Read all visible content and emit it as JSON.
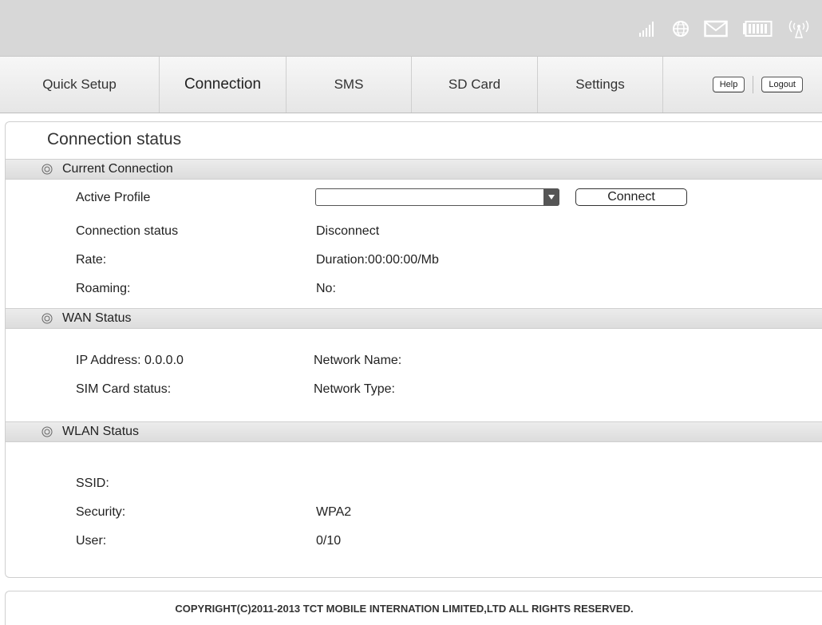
{
  "header": {
    "icons": [
      "signal-icon",
      "internet-globe-icon",
      "sms-envelope-icon",
      "battery-icon",
      "wifi-antenna-icon"
    ]
  },
  "nav": {
    "items": [
      {
        "label": "Quick Setup",
        "active": false
      },
      {
        "label": "Connection",
        "active": true
      },
      {
        "label": "SMS",
        "active": false
      },
      {
        "label": "SD Card",
        "active": false
      },
      {
        "label": "Settings",
        "active": false
      }
    ],
    "help_label": "Help",
    "logout_label": "Logout"
  },
  "page": {
    "title": "Connection status"
  },
  "current_connection": {
    "heading": "Current Connection",
    "active_profile_label": "Active Profile",
    "active_profile_value": "",
    "connect_label": "Connect",
    "connection_status_label": "Connection status",
    "connection_status_value": "Disconnect",
    "rate_label": "Rate:",
    "rate_value": "Duration:00:00:00/Mb",
    "roaming_label": "Roaming:",
    "roaming_value": "No:"
  },
  "wan_status": {
    "heading": "WAN Status",
    "ip_address": "IP Address: 0.0.0.0",
    "network_name": "Network Name:",
    "sim_card_status": "SIM Card status:",
    "network_type": "Network Type:"
  },
  "wlan_status": {
    "heading": "WLAN Status",
    "ssid_label": "SSID:",
    "ssid_value": "",
    "security_label": "Security:",
    "security_value": "WPA2",
    "user_label": "User:",
    "user_value": "0/10"
  },
  "footer": {
    "copyright": "COPYRIGHT(C)2011-2013 TCT MOBILE INTERNATION LIMITED,LTD ALL RIGHTS RESERVED."
  }
}
